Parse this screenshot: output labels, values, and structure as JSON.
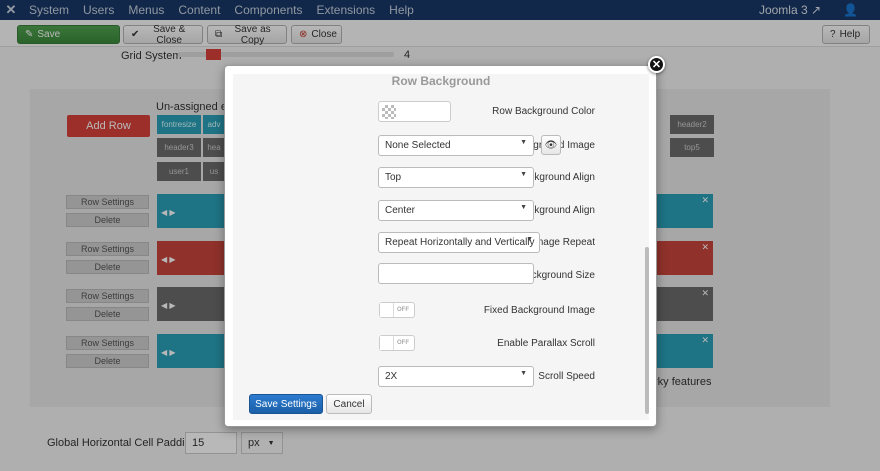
{
  "navbar": {
    "logo_icon": "joomla-icon",
    "items": [
      "System",
      "Users",
      "Menus",
      "Content",
      "Components",
      "Extensions",
      "Help"
    ],
    "brand": "Joomla 3",
    "brand_icon": "external-link-icon",
    "user_icon": "user-icon"
  },
  "toolbar": {
    "save_label": "Save",
    "save_close_label": "Save & Close",
    "save_copy_label": "Save as Copy",
    "close_label": "Close",
    "help_label": "Help"
  },
  "background": {
    "grid_system_label": "Grid System",
    "grid_system_value": "4",
    "unassigned_label": "Un-assigned ele",
    "add_row_label": "Add Row",
    "chips_row1": [
      "fontresize",
      "adv",
      "header2"
    ],
    "chips_row2": [
      "header3",
      "hea",
      "top5"
    ],
    "chips_row3": [
      "user1",
      "us"
    ],
    "row_settings_label": "Row Settings",
    "delete_label": "Delete",
    "quirky_text": "rky features",
    "padding_label": "Global Horizontal Cell Padding",
    "padding_value": "15",
    "padding_unit": "px"
  },
  "modal": {
    "title": "Row Background",
    "fields": {
      "row_bg_color": "Row Background Color",
      "bg_image": "Background Image",
      "bg_image_value": "None Selected",
      "vertical_align": "Vertical Background Align",
      "vertical_align_value": "Top",
      "horizontal_align": "Horizontal Background Align",
      "horizontal_align_value": "Center",
      "repeat": "Background Image Repeat",
      "repeat_value": "Repeat Horizontally and Vertically",
      "size": "Background Size",
      "fixed": "Fixed Background Image",
      "fixed_value": "OFF",
      "parallax": "Enable Parallax Scroll",
      "parallax_value": "OFF",
      "scroll_speed": "Scroll Speed",
      "scroll_speed_value": "2X"
    },
    "save_settings_label": "Save Settings",
    "cancel_label": "Cancel"
  },
  "colors": {
    "navbar": "#1a3867",
    "save_green": "#51a351",
    "primary_blue": "#2d7bcf",
    "add_row_red": "#d9423a",
    "row_teal": "#2aa0b9",
    "row_red": "#c8443c",
    "row_gray": "#6b6b6b"
  }
}
